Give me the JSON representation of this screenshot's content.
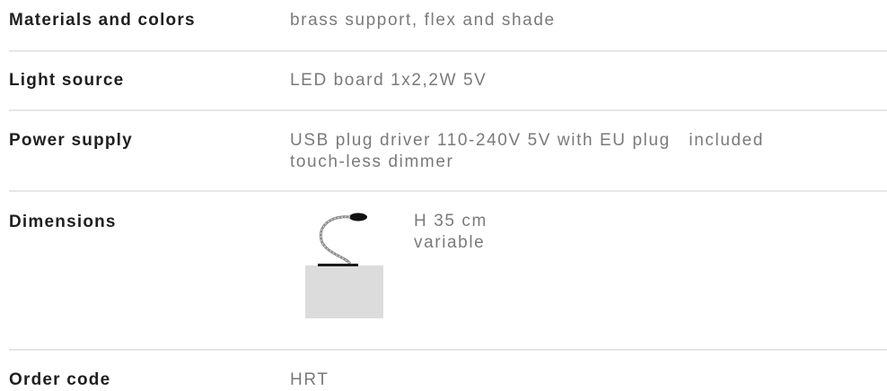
{
  "specs": {
    "materials": {
      "label": "Materials and colors",
      "value": "brass support, flex and shade"
    },
    "light_source": {
      "label": "Light source",
      "value": "LED board 1x2,2W 5V"
    },
    "power_supply": {
      "label": "Power supply",
      "value_line1": "USB plug driver 110-240V 5V with EU plug   included",
      "value_line2": "touch-less dimmer"
    },
    "dimensions": {
      "label": "Dimensions",
      "height": "H 35 cm",
      "note": "variable",
      "figure_icon": "desk-lamp-silhouette-icon"
    },
    "order_code": {
      "label": "Order code",
      "value": "HRT"
    }
  },
  "colors": {
    "label_text": "#1f1f1f",
    "value_text": "#7a7a7a",
    "divider": "#e6e6e6",
    "figure_box": "#dcdcdc"
  }
}
